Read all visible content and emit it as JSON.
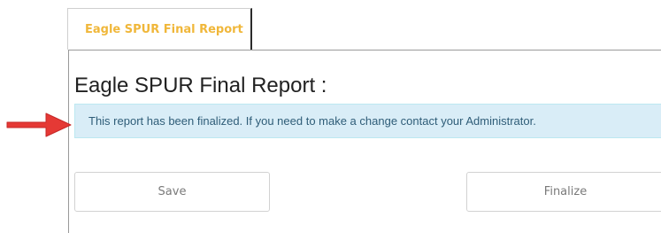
{
  "tab": {
    "label": "Eagle SPUR Final Report"
  },
  "report": {
    "title": "Eagle SPUR Final Report :",
    "alert_text": "This report has been finalized. If you need to make a change contact your Administrator."
  },
  "actions": {
    "save_label": "Save",
    "finalize_label": "Finalize"
  },
  "colors": {
    "tab_text": "#f0b73a",
    "alert_bg": "#d9edf7",
    "alert_text": "#2f5d78",
    "annotation_arrow": "#e53935"
  },
  "icons": {
    "annotation": "arrow-right-icon"
  }
}
